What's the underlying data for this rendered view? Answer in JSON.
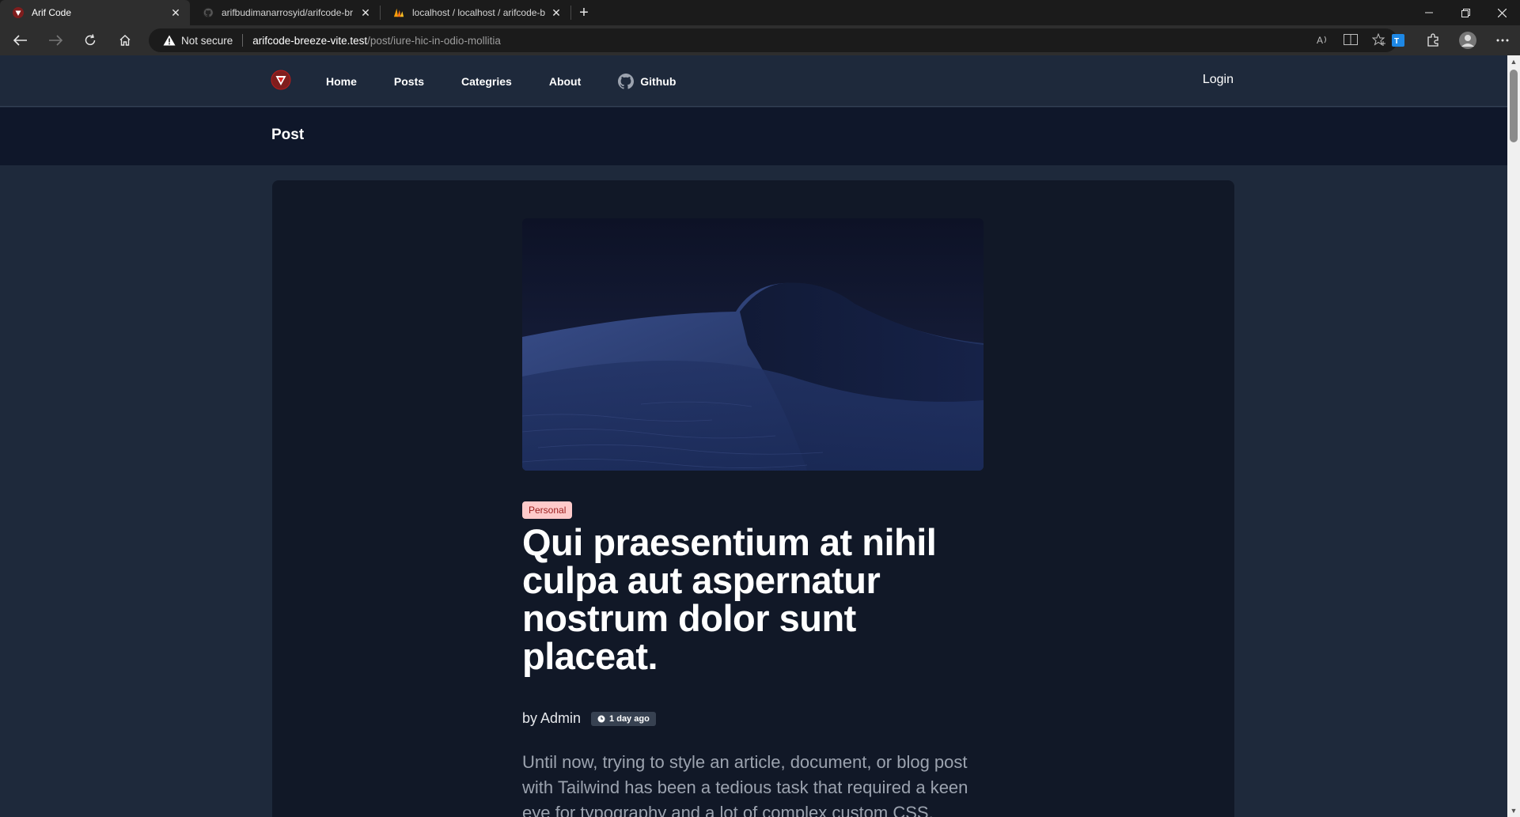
{
  "browser": {
    "tabs": [
      {
        "title": "Arif Code",
        "active": true
      },
      {
        "title": "arifbudimanarrosyid/arifcode-br",
        "active": false
      },
      {
        "title": "localhost / localhost / arifcode-b",
        "active": false
      }
    ],
    "address": {
      "security_label": "Not secure",
      "host": "arifcode-breeze-vite.test",
      "path": "/post/iure-hic-in-odio-mollitia"
    }
  },
  "site": {
    "nav": {
      "items": [
        "Home",
        "Posts",
        "Categries",
        "About",
        "Github"
      ],
      "login_label": "Login"
    },
    "page_heading": "Post"
  },
  "post": {
    "category": "Personal",
    "title": "Qui praesentium at nihil culpa aut aspernatur nostrum dolor sunt placeat.",
    "author": "by Admin",
    "time_ago": "1 day ago",
    "excerpt": "Until now, trying to style an article, document, or blog post with Tailwind has been a tedious task that required a keen eye for typography and a lot of complex custom CSS."
  },
  "colors": {
    "page_bg": "#1e293b",
    "header_bg": "#0f172a",
    "card_bg": "#111827",
    "badge_bg": "#fecaca",
    "badge_text": "#991b1b"
  }
}
